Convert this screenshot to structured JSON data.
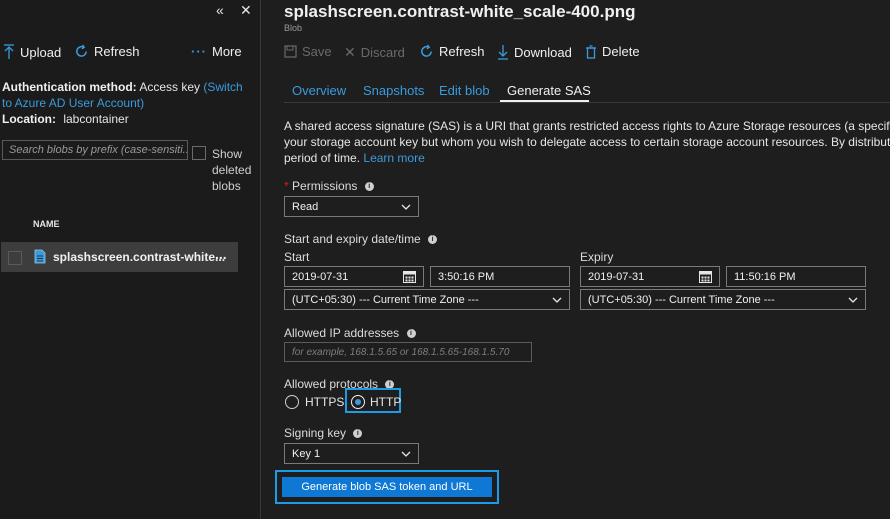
{
  "left": {
    "collapse_glyph": "«",
    "close_glyph": "✕",
    "toolbar": {
      "upload": "Upload",
      "refresh": "Refresh",
      "more": "More"
    },
    "auth": {
      "method_label": "Authentication method:",
      "method_value": "Access key",
      "switch_link": "(Switch to Azure AD User Account)",
      "location_label": "Location:",
      "location_value": "labcontainer"
    },
    "search": {
      "placeholder": "Search blobs by prefix (case-sensiti..."
    },
    "show_deleted_label": "Show deleted blobs",
    "list": {
      "header": "NAME",
      "items": [
        {
          "name": "splashscreen.contrast-white...",
          "more": "..."
        }
      ]
    }
  },
  "right": {
    "title": "splashscreen.contrast-white_scale-400.png",
    "subtitle": "Blob",
    "toolbar": {
      "save": "Save",
      "discard": "Discard",
      "refresh": "Refresh",
      "download": "Download",
      "delete": "Delete"
    },
    "tabs": [
      {
        "label": "Overview"
      },
      {
        "label": "Snapshots"
      },
      {
        "label": "Edit blob"
      },
      {
        "label": "Generate SAS"
      }
    ],
    "description_line1": "A shared access signature (SAS) is a URI that grants restricted access rights to Azure Storage resources (a specific blob",
    "description_line2": "your storage account key but whom you wish to delegate access to certain storage account resources. By distributing",
    "description_line3_text": "period of time.",
    "learn_more": "Learn more",
    "permissions": {
      "required_mark": "*",
      "label": "Permissions",
      "value": "Read"
    },
    "dates": {
      "label": "Start and expiry date/time",
      "start_label": "Start",
      "start_date": "2019-07-31",
      "start_time": "3:50:16 PM",
      "start_tz": "(UTC+05:30) --- Current Time Zone ---",
      "expiry_label": "Expiry",
      "expiry_date": "2019-07-31",
      "expiry_time": "11:50:16 PM",
      "expiry_tz": "(UTC+05:30) --- Current Time Zone ---"
    },
    "ip": {
      "label": "Allowed IP addresses",
      "placeholder": "for example, 168.1.5.65 or 168.1.5.65-168.1.5.70"
    },
    "protocols": {
      "label": "Allowed protocols",
      "https": "HTTPS",
      "http": "HTTP",
      "selected": "HTTP"
    },
    "signing_key": {
      "label": "Signing key",
      "value": "Key 1"
    },
    "generate_button": "Generate blob SAS token and URL"
  },
  "colors": {
    "accent": "#3a9bdc",
    "primary_button": "#0e78d4",
    "highlight_border": "#1c9be8",
    "required": "#e81123"
  }
}
